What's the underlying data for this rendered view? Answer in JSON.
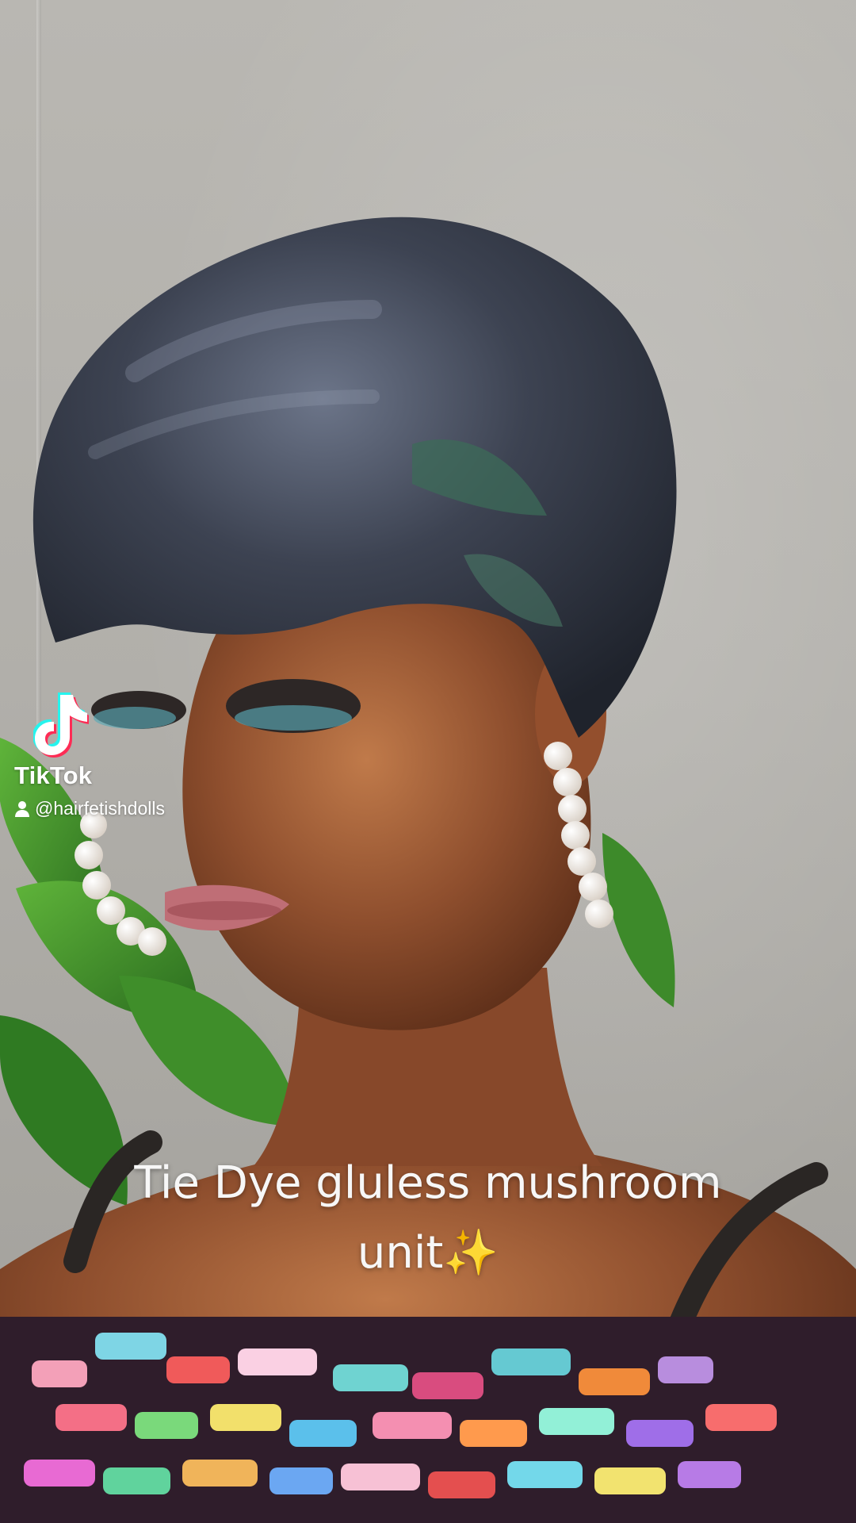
{
  "watermark": {
    "app_name": "TikTok",
    "handle": "@hairfetishdolls",
    "logo_icon": "tiktok-logo-icon",
    "user_icon": "person-icon"
  },
  "caption": {
    "text": "Tie Dye gluless mushroom unit✨"
  },
  "colors": {
    "caption": "#f7f7f7",
    "watermark": "#ffffff",
    "tiktok_cyan": "#25f4ee",
    "tiktok_pink": "#fe2c55"
  }
}
